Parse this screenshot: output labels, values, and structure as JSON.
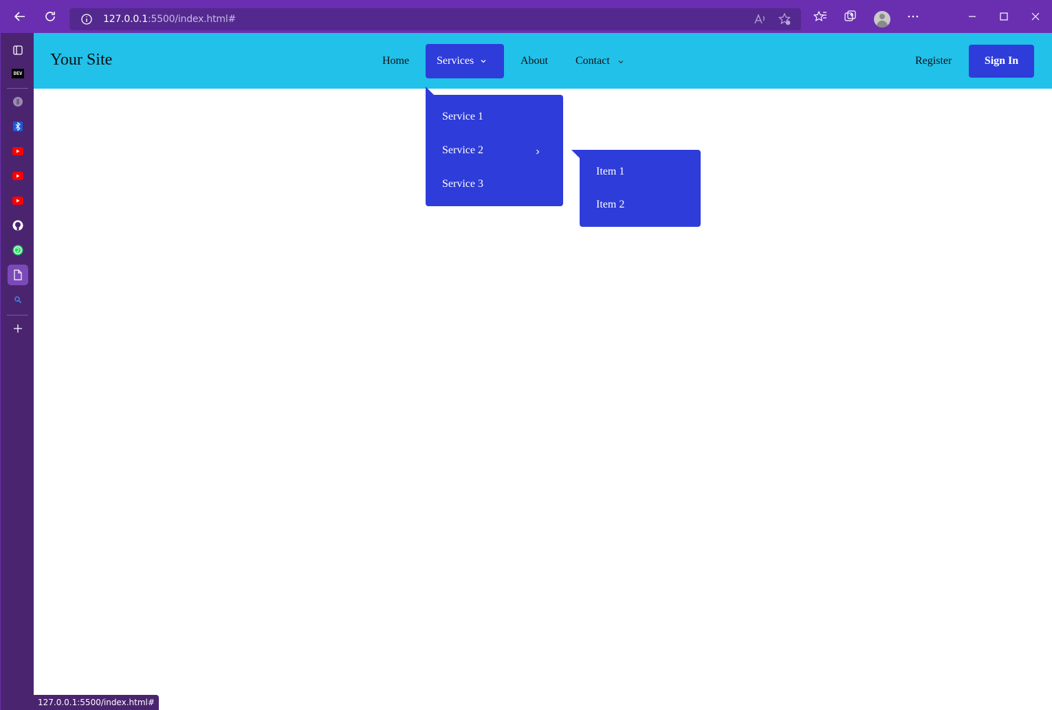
{
  "browser": {
    "url_host": "127.0.0.1",
    "url_rest": ":5500/index.html#",
    "status_url": "127.0.0.1:5500/index.html#",
    "sidebar_icons": [
      "tabs-icon",
      "dev-icon",
      "hashnode-icon",
      "bluetooth-icon",
      "youtube-icon",
      "youtube-icon",
      "youtube-icon",
      "github-icon",
      "whatsapp-icon",
      "page-icon",
      "search-icon",
      "add-icon"
    ],
    "dev_label": "DEV"
  },
  "site": {
    "brand": "Your Site",
    "nav": {
      "home": "Home",
      "services": "Services",
      "about": "About",
      "contact": "Contact",
      "register": "Register",
      "signin": "Sign In"
    },
    "services_menu": [
      "Service 1",
      "Service 2",
      "Service 3"
    ],
    "service2_submenu": [
      "Item 1",
      "Item 2"
    ]
  },
  "colors": {
    "navbar": "#21c1ea",
    "accent": "#2e3cd9",
    "chrome": "#6a2fb0"
  }
}
